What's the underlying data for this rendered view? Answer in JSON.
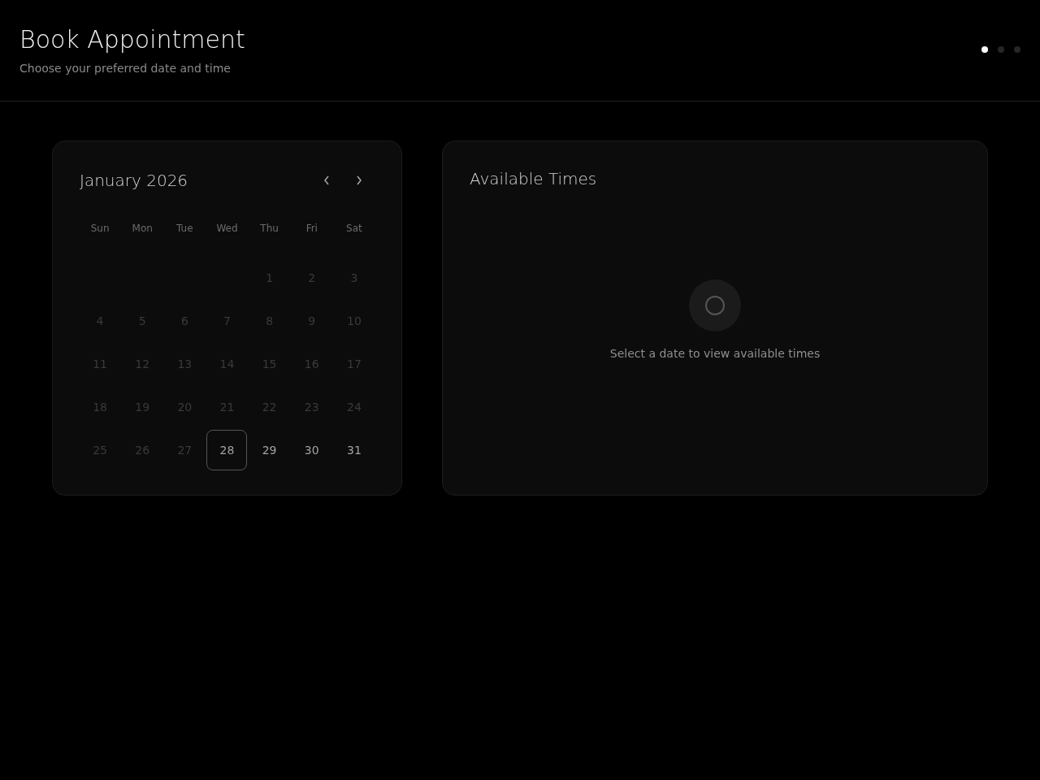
{
  "header": {
    "title": "Book Appointment",
    "subtitle": "Choose your preferred date and time"
  },
  "steps": [
    {
      "selected": true
    },
    {
      "selected": false
    },
    {
      "selected": false
    }
  ],
  "calendar": {
    "month": "January 2026",
    "weekdays": [
      "Sun",
      "Mon",
      "Tue",
      "Wed",
      "Thu",
      "Fri",
      "Sat"
    ],
    "weeks": [
      [
        {
          "day": "1",
          "disabled": true,
          "today": false
        },
        {
          "day": "2",
          "disabled": true,
          "today": false
        },
        {
          "day": "3",
          "disabled": true,
          "today": false
        }
      ],
      [
        {
          "day": "4",
          "disabled": true,
          "today": false
        },
        {
          "day": "5",
          "disabled": true,
          "today": false
        },
        {
          "day": "6",
          "disabled": true,
          "today": false
        },
        {
          "day": "7",
          "disabled": true,
          "today": false
        },
        {
          "day": "8",
          "disabled": true,
          "today": false
        },
        {
          "day": "9",
          "disabled": true,
          "today": false
        },
        {
          "day": "10",
          "disabled": true,
          "today": false
        }
      ],
      [
        {
          "day": "11",
          "disabled": true,
          "today": false
        },
        {
          "day": "12",
          "disabled": true,
          "today": false
        },
        {
          "day": "13",
          "disabled": true,
          "today": false
        },
        {
          "day": "14",
          "disabled": true,
          "today": false
        },
        {
          "day": "15",
          "disabled": true,
          "today": false
        },
        {
          "day": "16",
          "disabled": true,
          "today": false
        },
        {
          "day": "17",
          "disabled": true,
          "today": false
        }
      ],
      [
        {
          "day": "18",
          "disabled": true,
          "today": false
        },
        {
          "day": "19",
          "disabled": true,
          "today": false
        },
        {
          "day": "20",
          "disabled": true,
          "today": false
        },
        {
          "day": "21",
          "disabled": true,
          "today": false
        },
        {
          "day": "22",
          "disabled": true,
          "today": false
        },
        {
          "day": "23",
          "disabled": true,
          "today": false
        },
        {
          "day": "24",
          "disabled": true,
          "today": false
        }
      ],
      [
        {
          "day": "25",
          "disabled": true,
          "today": false
        },
        {
          "day": "26",
          "disabled": true,
          "today": false
        },
        {
          "day": "27",
          "disabled": true,
          "today": false
        },
        {
          "day": "28",
          "disabled": false,
          "today": true
        },
        {
          "day": "29",
          "disabled": false,
          "today": false
        },
        {
          "day": "30",
          "disabled": false,
          "today": false
        },
        {
          "day": "31",
          "disabled": false,
          "today": false
        }
      ]
    ]
  },
  "times": {
    "title": "Available Times",
    "empty_message": "Select a date to view available times"
  }
}
